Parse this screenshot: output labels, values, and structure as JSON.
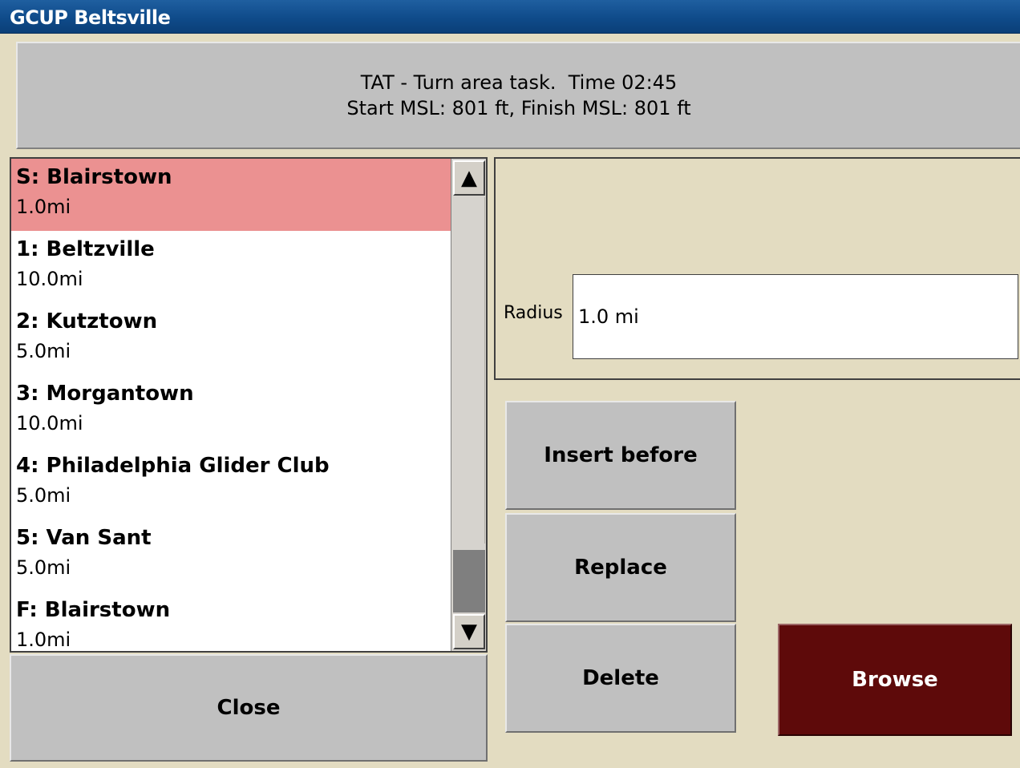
{
  "window": {
    "title": "GCUP Beltsville"
  },
  "task": {
    "line1": "TAT - Turn area task.  Time 02:45",
    "line2": "Start MSL: 801 ft, Finish MSL: 801 ft"
  },
  "turnpoints": [
    {
      "name": "S: Blairstown",
      "distance": "1.0mi",
      "selected": true
    },
    {
      "name": "1: Beltzville",
      "distance": "10.0mi",
      "selected": false
    },
    {
      "name": "2: Kutztown",
      "distance": "5.0mi",
      "selected": false
    },
    {
      "name": "3: Morgantown",
      "distance": "10.0mi",
      "selected": false
    },
    {
      "name": "4: Philadelphia Glider Club",
      "distance": "5.0mi",
      "selected": false
    },
    {
      "name": "5: Van Sant",
      "distance": "5.0mi",
      "selected": false
    },
    {
      "name": "F: Blairstown",
      "distance": "1.0mi",
      "selected": false
    }
  ],
  "scrollbar": {
    "up_icon": "triangle-up",
    "down_icon": "triangle-down",
    "up_glyph": "▲",
    "down_glyph": "▼"
  },
  "properties": {
    "radius_label": "Radius",
    "radius_value": "1.0 mi"
  },
  "buttons": {
    "insert_before": "Insert before",
    "replace": "Replace",
    "delete": "Delete",
    "browse": "Browse",
    "close": "Close"
  },
  "colors": {
    "selected_row": "#eb9191",
    "browse_button": "#5e0a0a",
    "background": "#e3dcc1",
    "title_bar": "#0f4b8a"
  }
}
